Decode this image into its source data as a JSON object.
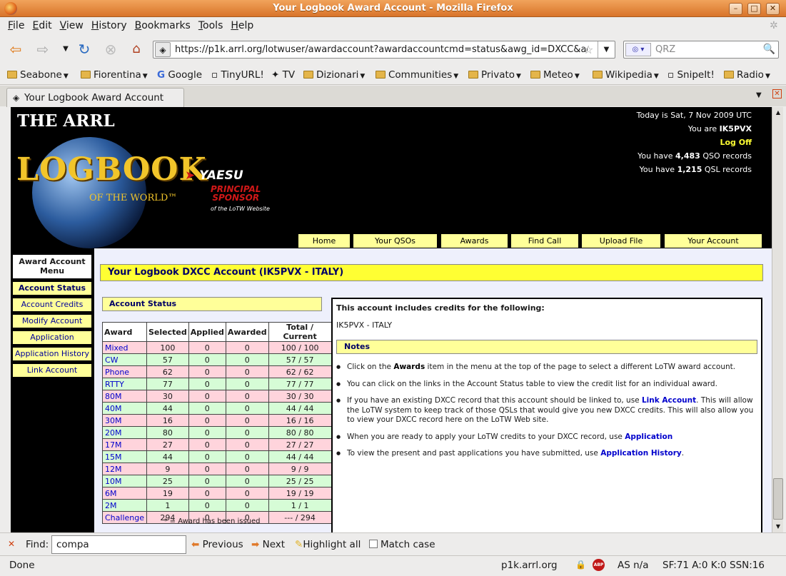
{
  "window": {
    "title": "Your Logbook Award Account - Mozilla Firefox"
  },
  "menu": [
    "File",
    "Edit",
    "View",
    "History",
    "Bookmarks",
    "Tools",
    "Help"
  ],
  "nav": {
    "url": "https://p1k.arrl.org/lotwuser/awardaccount?awardaccountcmd=status&awg_id=DXCC&ac",
    "search_placeholder": "QRZ"
  },
  "bookmarks": [
    "Seabone",
    "Fiorentina",
    "Google",
    "TinyURL!",
    "TV",
    "Dizionari",
    "Communities",
    "Privato",
    "Meteo",
    "Wikipedia",
    "SnipeIt!",
    "Radio"
  ],
  "tab": {
    "label": "Your Logbook Award Account"
  },
  "header": {
    "brand_line1": "THE ARRL",
    "brand_line2": "LOGBOOK",
    "brand_line3": "OF THE WORLD™",
    "sponsor_name": "YAESU",
    "sponsor_line1": "PRINCIPAL",
    "sponsor_line2": "SPONSOR",
    "sponsor_line3": "of the LoTW Website",
    "today": "Today is Sat, 7 Nov 2009 UTC",
    "you_are_prefix": "You are ",
    "callsign": "IK5PVX",
    "logoff": "Log Off",
    "qso_prefix": "You have ",
    "qso_count": "4,483",
    "qso_suffix": " QSO records",
    "qsl_prefix": "You have ",
    "qsl_count": "1,215",
    "qsl_suffix": " QSL records"
  },
  "topnav": [
    "Home",
    "Your QSOs",
    "Awards",
    "Find Call",
    "Upload File",
    "Your Account"
  ],
  "sidemenu": {
    "title": "Award Account Menu",
    "items": [
      "Account Status",
      "Account Credits",
      "Modify Account",
      "Application",
      "Application History",
      "Link Account"
    ]
  },
  "page_title": "Your Logbook DXCC Account (IK5PVX - ITALY)",
  "status": {
    "heading": "Account Status",
    "columns": [
      "Award",
      "Selected",
      "Applied",
      "Awarded",
      "Total / Current"
    ],
    "rows": [
      {
        "award": "Mixed",
        "selected": "100",
        "applied": "0",
        "awarded": "0",
        "total": "100 / 100"
      },
      {
        "award": "CW",
        "selected": "57",
        "applied": "0",
        "awarded": "0",
        "total": "57 / 57"
      },
      {
        "award": "Phone",
        "selected": "62",
        "applied": "0",
        "awarded": "0",
        "total": "62 / 62"
      },
      {
        "award": "RTTY",
        "selected": "77",
        "applied": "0",
        "awarded": "0",
        "total": "77 / 77"
      },
      {
        "award": "80M",
        "selected": "30",
        "applied": "0",
        "awarded": "0",
        "total": "30 / 30"
      },
      {
        "award": "40M",
        "selected": "44",
        "applied": "0",
        "awarded": "0",
        "total": "44 / 44"
      },
      {
        "award": "30M",
        "selected": "16",
        "applied": "0",
        "awarded": "0",
        "total": "16 / 16"
      },
      {
        "award": "20M",
        "selected": "80",
        "applied": "0",
        "awarded": "0",
        "total": "80 / 80"
      },
      {
        "award": "17M",
        "selected": "27",
        "applied": "0",
        "awarded": "0",
        "total": "27 / 27"
      },
      {
        "award": "15M",
        "selected": "44",
        "applied": "0",
        "awarded": "0",
        "total": "44 / 44"
      },
      {
        "award": "12M",
        "selected": "9",
        "applied": "0",
        "awarded": "0",
        "total": "9 / 9"
      },
      {
        "award": "10M",
        "selected": "25",
        "applied": "0",
        "awarded": "0",
        "total": "25 / 25"
      },
      {
        "award": "6M",
        "selected": "19",
        "applied": "0",
        "awarded": "0",
        "total": "19 / 19"
      },
      {
        "award": "2M",
        "selected": "1",
        "applied": "0",
        "awarded": "0",
        "total": "1 / 1"
      },
      {
        "award": "Challenge",
        "selected": "294",
        "applied": "0",
        "awarded": "0",
        "total": "--- / 294"
      }
    ],
    "footnote": "* = Award has been issued"
  },
  "credits": {
    "heading": "This account includes credits for the following:",
    "entity": "IK5PVX - ITALY",
    "notes_heading": "Notes",
    "n1a": "Click on the ",
    "n1b": "Awards",
    "n1c": " item in the menu at the top of the page to select a different LoTW award account.",
    "n2": "You can click on the links in the Account Status table to view the credit list for an individual award.",
    "n3a": "If you have an existing DXCC record that this account should be linked to, use ",
    "n3b": "Link Account",
    "n3c": ". This will allow the LoTW system to keep track of those QSLs that would give you new DXCC credits. This will also allow you to view your DXCC record here on the LoTW Web site.",
    "n4a": "When you are ready to apply your LoTW credits to your DXCC record, use ",
    "n4b": "Application",
    "n5a": "To view the present and past applications you have submitted, use ",
    "n5b": "Application History",
    "n5c": "."
  },
  "find": {
    "label": "Find:",
    "value": "compa",
    "previous": "Previous",
    "next": "Next",
    "highlight": "Highlight all",
    "match": "Match case"
  },
  "status_bar": {
    "left": "Done",
    "host": "p1k.arrl.org",
    "as": "AS n/a",
    "stats": "SF:71 A:0 K:0 SSN:16"
  }
}
